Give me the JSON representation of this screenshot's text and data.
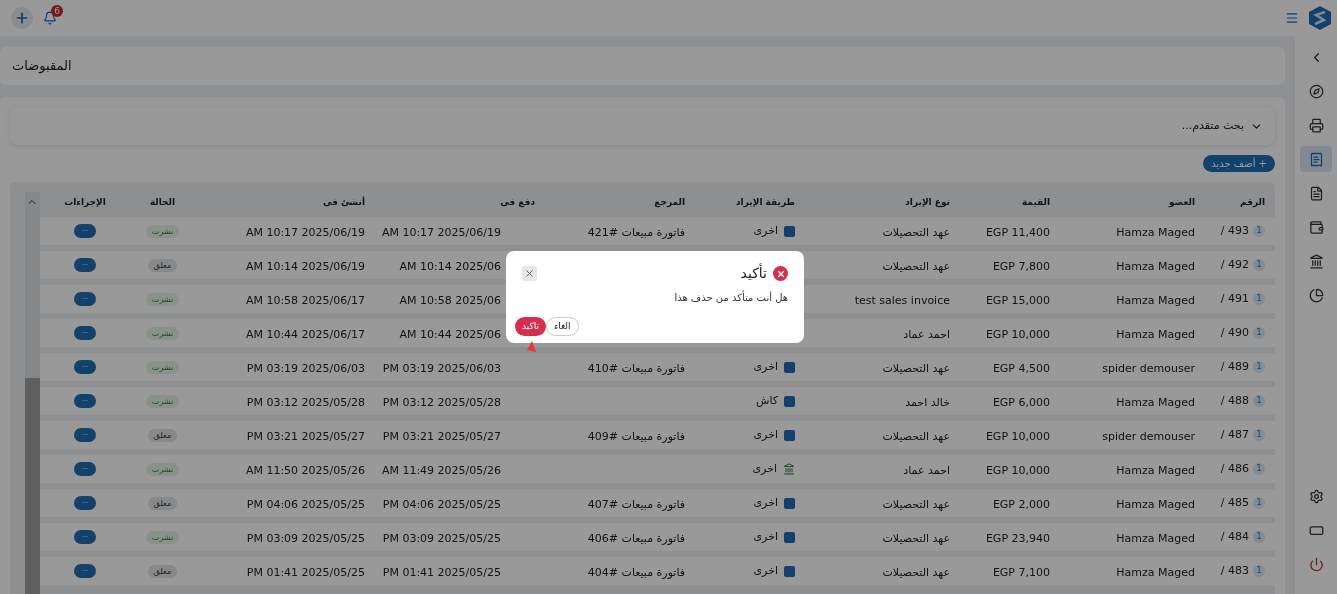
{
  "topbar": {
    "notification_count": "6"
  },
  "sidebar": {
    "items": [
      {
        "kind": "collapse",
        "selected": false
      },
      {
        "kind": "compass",
        "selected": false
      },
      {
        "kind": "printer",
        "selected": false
      },
      {
        "kind": "receipt",
        "selected": true
      },
      {
        "kind": "document",
        "selected": false
      },
      {
        "kind": "wallet",
        "selected": false
      },
      {
        "kind": "bank",
        "selected": false
      },
      {
        "kind": "chart",
        "selected": false
      }
    ],
    "bottom_items": [
      {
        "kind": "settings"
      },
      {
        "kind": "screen"
      },
      {
        "kind": "power"
      }
    ]
  },
  "page_title": "المقبوضات",
  "advanced_search": {
    "label": "بحث متقدم...",
    "expanded": false
  },
  "add_button": "+ أضف جديد",
  "table": {
    "columns": [
      "الرقم",
      "العضو",
      "القيمة",
      "نوع الإيراد",
      "طريقة الإيراد",
      "المرجع",
      "دفع فى",
      "أنشئ فى",
      "الحالة",
      "الإجراءات"
    ],
    "rows": [
      {
        "number": "493 /",
        "count": "1",
        "member": "Hamza Maged",
        "value": "EGP 11,400",
        "type": "عهد التحصيلات",
        "method": {
          "text": "اخرى",
          "kind": "card"
        },
        "reference": "فاتورة مبيعات #421",
        "paid_at": "AM 10:17 2025/06/19",
        "created_at": "AM 10:17 2025/06/19",
        "status": {
          "text": "نشرت",
          "kind": "published"
        },
        "action": "···"
      },
      {
        "number": "492 /",
        "count": "1",
        "member": "Hamza Maged",
        "value": "EGP 7,800",
        "type": "عهد التحصيلات",
        "paid_at": "AM 10:14 2025/06",
        "created_at": "AM 10:14 2025/06/19",
        "status": {
          "text": "معلق",
          "kind": "pending"
        },
        "action": "···"
      },
      {
        "number": "491 /",
        "count": "1",
        "member": "Hamza Maged",
        "value": "EGP 15,000",
        "type": "test sales invoice",
        "paid_at": "AM 10:58 2025/06",
        "created_at": "AM 10:58 2025/06/17",
        "status": {
          "text": "نشرت",
          "kind": "published"
        },
        "action": "···"
      },
      {
        "number": "490 /",
        "count": "1",
        "member": "Hamza Maged",
        "value": "EGP 10,000",
        "type": "احمد عماد",
        "paid_at": "AM 10:44 2025/06",
        "created_at": "AM 10:44 2025/06/17",
        "status": {
          "text": "نشرت",
          "kind": "published"
        },
        "action": "···"
      },
      {
        "number": "489 /",
        "count": "1",
        "member": "spider demouser",
        "value": "EGP 4,500",
        "type": "عهد التحصيلات",
        "method": {
          "text": "اخرى",
          "kind": "card"
        },
        "reference": "فاتورة مبيعات #410",
        "paid_at": "PM 03:19 2025/06/03",
        "created_at": "PM 03:19 2025/06/03",
        "status": {
          "text": "نشرت",
          "kind": "published"
        },
        "action": "···"
      },
      {
        "number": "488 /",
        "count": "1",
        "member": "Hamza Maged",
        "value": "EGP 6,000",
        "type": "خالد احمد",
        "method": {
          "text": "كاش",
          "kind": "card"
        },
        "paid_at": "PM 03:12 2025/05/28",
        "created_at": "PM 03:12 2025/05/28",
        "status": {
          "text": "نشرت",
          "kind": "published"
        },
        "action": "···"
      },
      {
        "number": "487 /",
        "count": "1",
        "member": "spider demouser",
        "value": "EGP 10,000",
        "type": "عهد التحصيلات",
        "method": {
          "text": "اخرى",
          "kind": "card"
        },
        "reference": "فاتورة مبيعات #409",
        "paid_at": "PM 03:21 2025/05/27",
        "created_at": "PM 03:21 2025/05/27",
        "status": {
          "text": "معلق",
          "kind": "pending"
        },
        "action": "···"
      },
      {
        "number": "486 /",
        "count": "1",
        "member": "Hamza Maged",
        "value": "EGP 10,000",
        "type": "احمد عماد",
        "method": {
          "text": "اخرى",
          "kind": "bank"
        },
        "paid_at": "AM 11:49 2025/05/26",
        "created_at": "AM 11:50 2025/05/26",
        "status": {
          "text": "نشرت",
          "kind": "published"
        },
        "action": "···"
      },
      {
        "number": "485 /",
        "count": "1",
        "member": "Hamza Maged",
        "value": "EGP 2,000",
        "type": "عهد التحصيلات",
        "method": {
          "text": "اخرى",
          "kind": "card"
        },
        "reference": "فاتورة مبيعات #407",
        "paid_at": "PM 04:06 2025/05/25",
        "created_at": "PM 04:06 2025/05/25",
        "status": {
          "text": "معلق",
          "kind": "pending"
        },
        "action": "···"
      },
      {
        "number": "484 /",
        "count": "1",
        "member": "Hamza Maged",
        "value": "EGP 23,940",
        "type": "عهد التحصيلات",
        "method": {
          "text": "اخرى",
          "kind": "card"
        },
        "reference": "فاتورة مبيعات #406",
        "paid_at": "PM 03:09 2025/05/25",
        "created_at": "PM 03:09 2025/05/25",
        "status": {
          "text": "نشرت",
          "kind": "published"
        },
        "action": "···"
      },
      {
        "number": "483 /",
        "count": "1",
        "member": "Hamza Maged",
        "value": "EGP 7,100",
        "type": "عهد التحصيلات",
        "method": {
          "text": "اخرى",
          "kind": "card"
        },
        "reference": "فاتورة مبيعات #404",
        "paid_at": "PM 01:41 2025/05/25",
        "created_at": "PM 01:41 2025/05/25",
        "status": {
          "text": "معلق",
          "kind": "pending"
        },
        "action": "···"
      }
    ]
  },
  "dialog": {
    "title": "تأكيد",
    "message": "هل أنت متأكد من حذف هذا",
    "confirm": "تاكيد",
    "cancel": "الغاء"
  }
}
